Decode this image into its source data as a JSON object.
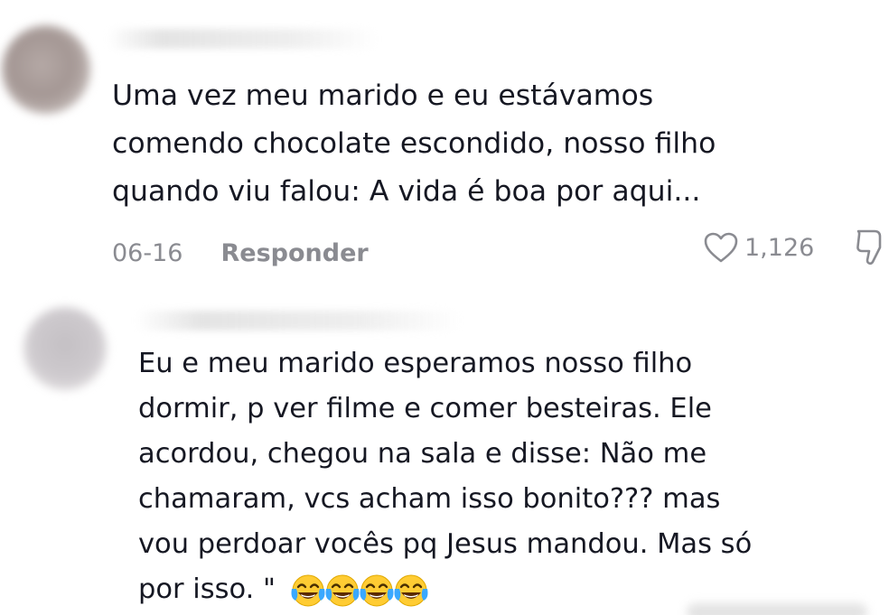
{
  "comments": [
    {
      "text": "Uma vez meu marido e eu estávamos\ncomendo chocolate escondido, nosso filho\nquando viu falou: A vida é boa por aqui...",
      "date": "06-16",
      "reply_label": "Responder",
      "like_count": "1,126",
      "like_icon": "heart-outline-icon",
      "dislike_icon": "thumbs-down-icon"
    },
    {
      "text": "Eu e meu marido esperamos nosso filho\ndormir, p ver filme e comer besteiras. Ele\nacordou, chegou na sala e disse: Não me\nchamaram, vcs acham isso bonito??? mas\nvou perdoar vocês pq Jesus mandou. Mas só\npor isso. \"",
      "emoji": "face-with-tears-of-joy-icon",
      "emoji_count": 4
    }
  ],
  "colors": {
    "text": "#161823",
    "muted": "#8a8b91"
  }
}
